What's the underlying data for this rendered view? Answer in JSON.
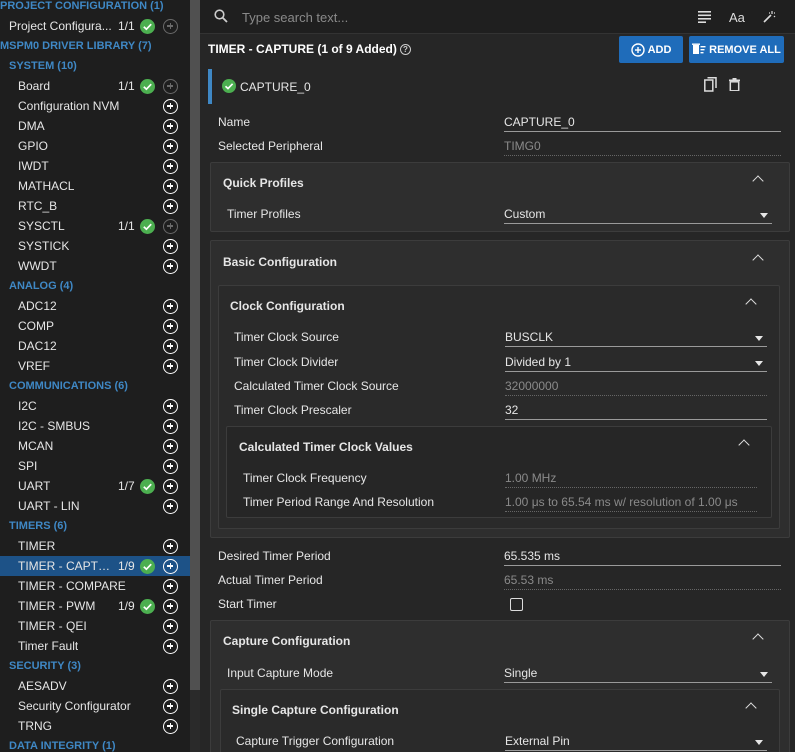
{
  "sidebar": {
    "rows": [
      {
        "kind": "hdr",
        "label": "PROJECT CONFIGURATION (1)"
      },
      {
        "kind": "item",
        "label": "Project Configura...",
        "count": "1/1",
        "check": true,
        "plus": "disabled"
      },
      {
        "kind": "hdr",
        "label": "MSPM0 DRIVER LIBRARY (7)"
      },
      {
        "kind": "hdr",
        "label": "SYSTEM (10)",
        "sub": true
      },
      {
        "kind": "item",
        "label": "Board",
        "count": "1/1",
        "check": true,
        "plus": "disabled"
      },
      {
        "kind": "item",
        "label": "Configuration NVM",
        "plus": "on"
      },
      {
        "kind": "item",
        "label": "DMA",
        "plus": "on"
      },
      {
        "kind": "item",
        "label": "GPIO",
        "plus": "on"
      },
      {
        "kind": "item",
        "label": "IWDT",
        "plus": "on"
      },
      {
        "kind": "item",
        "label": "MATHACL",
        "plus": "on"
      },
      {
        "kind": "item",
        "label": "RTC_B",
        "plus": "on"
      },
      {
        "kind": "item",
        "label": "SYSCTL",
        "count": "1/1",
        "check": true,
        "plus": "disabled"
      },
      {
        "kind": "item",
        "label": "SYSTICK",
        "plus": "on"
      },
      {
        "kind": "item",
        "label": "WWDT",
        "plus": "on"
      },
      {
        "kind": "hdr",
        "label": "ANALOG (4)",
        "sub": true
      },
      {
        "kind": "item",
        "label": "ADC12",
        "plus": "on"
      },
      {
        "kind": "item",
        "label": "COMP",
        "plus": "on"
      },
      {
        "kind": "item",
        "label": "DAC12",
        "plus": "on"
      },
      {
        "kind": "item",
        "label": "VREF",
        "plus": "on"
      },
      {
        "kind": "hdr",
        "label": "COMMUNICATIONS (6)",
        "sub": true
      },
      {
        "kind": "item",
        "label": "I2C",
        "plus": "on"
      },
      {
        "kind": "item",
        "label": "I2C - SMBUS",
        "plus": "on"
      },
      {
        "kind": "item",
        "label": "MCAN",
        "plus": "on"
      },
      {
        "kind": "item",
        "label": "SPI",
        "plus": "on"
      },
      {
        "kind": "item",
        "label": "UART",
        "count": "1/7",
        "check": true,
        "plus": "on"
      },
      {
        "kind": "item",
        "label": "UART - LIN",
        "plus": "on"
      },
      {
        "kind": "hdr",
        "label": "TIMERS (6)",
        "sub": true
      },
      {
        "kind": "item",
        "label": "TIMER",
        "plus": "on"
      },
      {
        "kind": "item",
        "label": "TIMER - CAPTU...",
        "count": "1/9",
        "check": true,
        "plus": "on",
        "selected": true
      },
      {
        "kind": "item",
        "label": "TIMER - COMPARE",
        "plus": "on"
      },
      {
        "kind": "item",
        "label": "TIMER - PWM",
        "count": "1/9",
        "check": true,
        "plus": "on"
      },
      {
        "kind": "item",
        "label": "TIMER - QEI",
        "plus": "on"
      },
      {
        "kind": "item",
        "label": "Timer Fault",
        "plus": "on"
      },
      {
        "kind": "hdr",
        "label": "SECURITY (3)",
        "sub": true
      },
      {
        "kind": "item",
        "label": "AESADV",
        "plus": "on"
      },
      {
        "kind": "item",
        "label": "Security Configurator",
        "plus": "on"
      },
      {
        "kind": "item",
        "label": "TRNG",
        "plus": "on"
      },
      {
        "kind": "hdr",
        "label": "DATA INTEGRITY (1)",
        "sub": true
      }
    ]
  },
  "search": {
    "placeholder": "Type search text..."
  },
  "toolbar": {
    "font_label": "Aa"
  },
  "header": {
    "title": "TIMER - CAPTURE (1 of 9 Added)",
    "add_label": "ADD",
    "remove_all_label": "REMOVE ALL"
  },
  "instance": {
    "name": "CAPTURE_0"
  },
  "fields": {
    "name": {
      "label": "Name",
      "value": "CAPTURE_0"
    },
    "peripheral": {
      "label": "Selected Peripheral",
      "value": "TIMG0"
    },
    "desired_period": {
      "label": "Desired Timer Period",
      "value": "65.535 ms"
    },
    "actual_period": {
      "label": "Actual Timer Period",
      "value": "65.53 ms"
    },
    "start_timer": {
      "label": "Start Timer"
    }
  },
  "quick_profiles": {
    "title": "Quick Profiles",
    "profiles_label": "Timer Profiles",
    "profiles_value": "Custom"
  },
  "basic": {
    "title": "Basic Configuration"
  },
  "clock": {
    "title": "Clock Configuration",
    "source_label": "Timer Clock Source",
    "source_value": "BUSCLK",
    "divider_label": "Timer Clock Divider",
    "divider_value": "Divided by 1",
    "calc_label": "Calculated Timer Clock Source",
    "calc_value": "32000000",
    "prescaler_label": "Timer Clock Prescaler",
    "prescaler_value": "32"
  },
  "calc_values": {
    "title": "Calculated Timer Clock Values",
    "freq_label": "Timer Clock Frequency",
    "freq_value": "1.00 MHz",
    "range_label": "Timer Period Range And Resolution",
    "range_value": "1.00 μs to 65.54 ms w/ resolution of 1.00 μs"
  },
  "capture": {
    "title": "Capture Configuration",
    "mode_label": "Input Capture Mode",
    "mode_value": "Single"
  },
  "single_capture": {
    "title": "Single Capture Configuration",
    "trigger_label": "Capture Trigger Configuration",
    "trigger_value": "External Pin"
  },
  "colors": {
    "accent": "#1f6cba",
    "header": "#3f88c5",
    "ok": "#4caf50",
    "selected": "#1d5287"
  }
}
